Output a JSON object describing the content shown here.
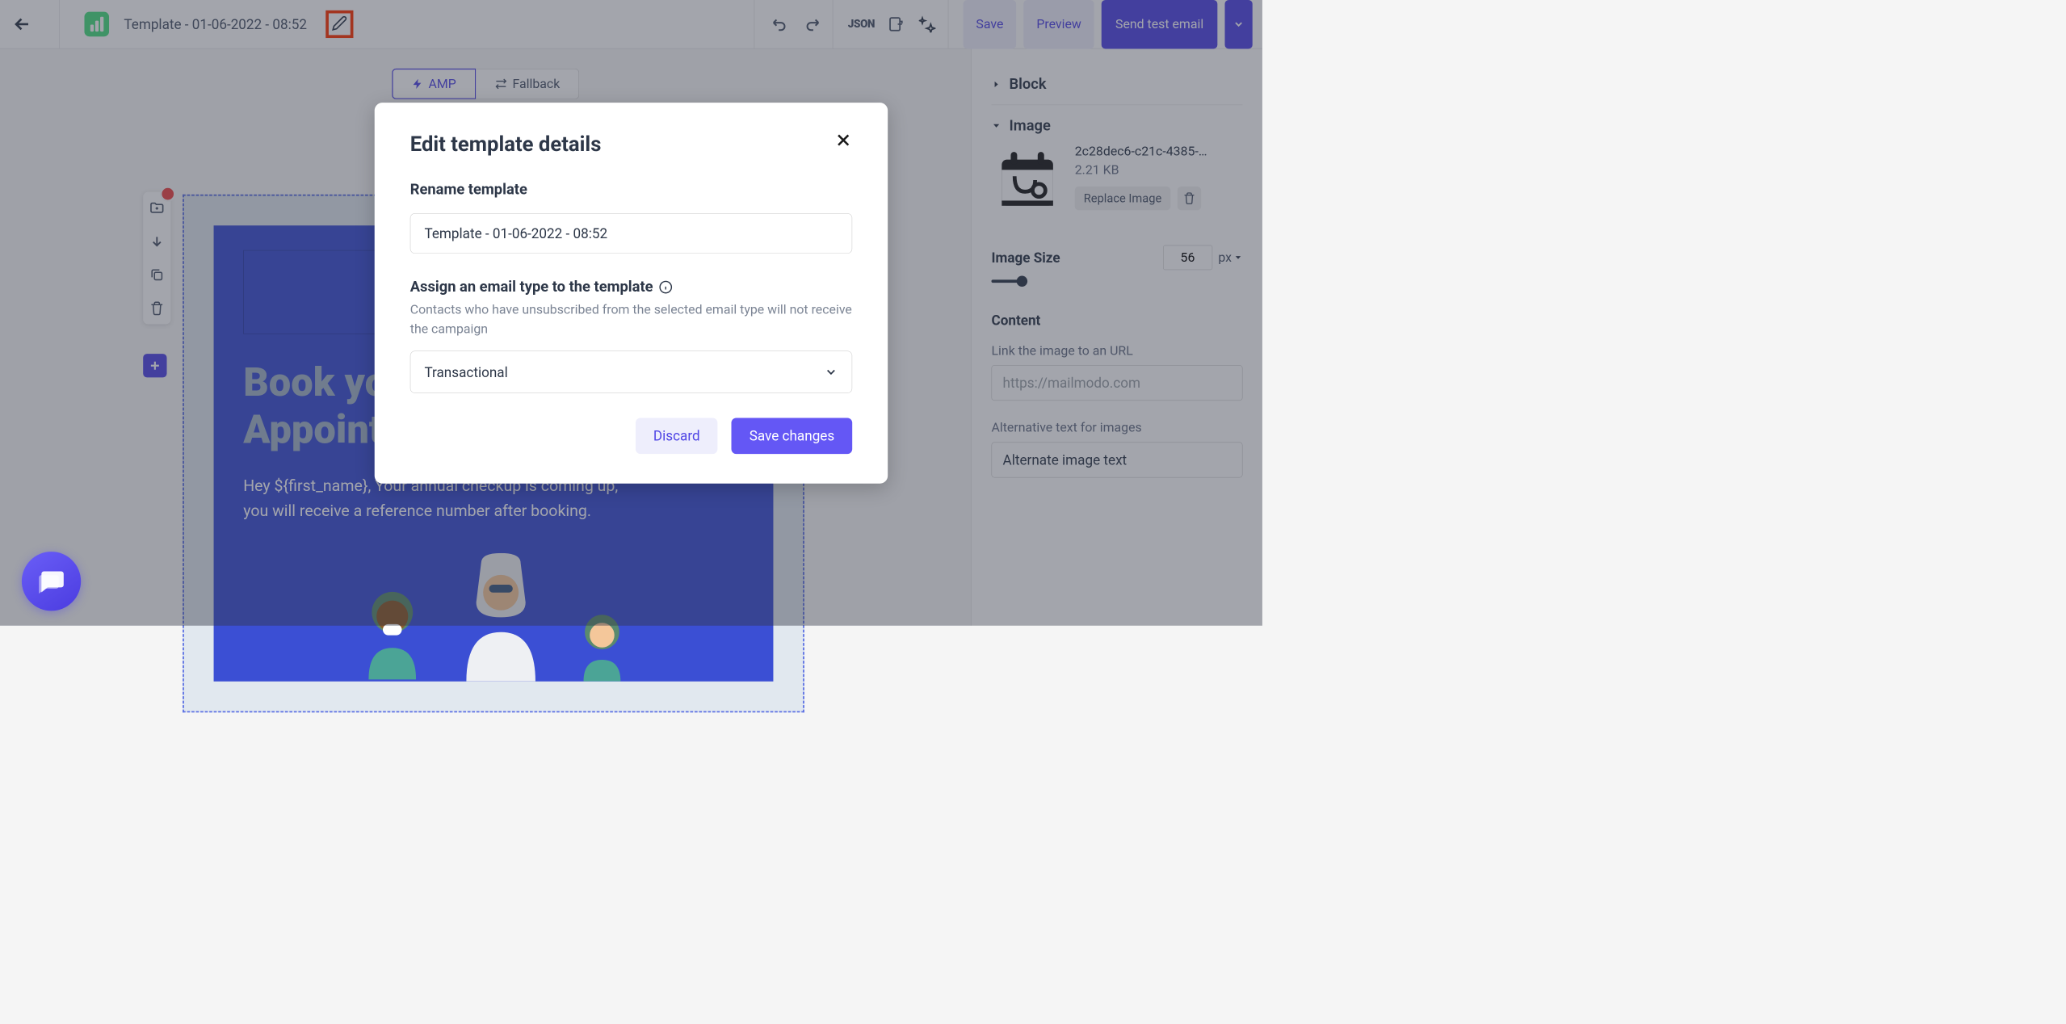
{
  "header": {
    "template_name": "Template - 01-06-2022 - 08:52",
    "json_label": "JSON",
    "save_label": "Save",
    "preview_label": "Preview",
    "send_test_label": "Send test email"
  },
  "view_tabs": {
    "amp_label": "AMP",
    "fallback_label": "Fallback"
  },
  "email": {
    "title_line1": "Book your",
    "title_line2": "Appointment",
    "body_line1": "Hey ${first_name}, Your annual checkup is coming up,",
    "body_line2": "you will receive a reference number after booking."
  },
  "right_panel": {
    "block_label": "Block",
    "image_label": "Image",
    "image_filename": "2c28dec6-c21c-4385-…",
    "image_size_kb": "2.21 KB",
    "replace_label": "Replace Image",
    "size_section": "Image Size",
    "size_value": "56",
    "unit_label": "px",
    "content_section": "Content",
    "link_label": "Link the image to an URL",
    "link_placeholder": "https://mailmodo.com",
    "alt_label": "Alternative text for images",
    "alt_value": "Alternate image text"
  },
  "modal": {
    "title": "Edit template details",
    "rename_label": "Rename template",
    "rename_value": "Template - 01-06-2022 - 08:52",
    "assign_label": "Assign an email type to the template",
    "assign_note": "Contacts who have unsubscribed from the selected email type will not receive the campaign",
    "email_type_value": "Transactional",
    "discard_label": "Discard",
    "save_label": "Save changes"
  }
}
